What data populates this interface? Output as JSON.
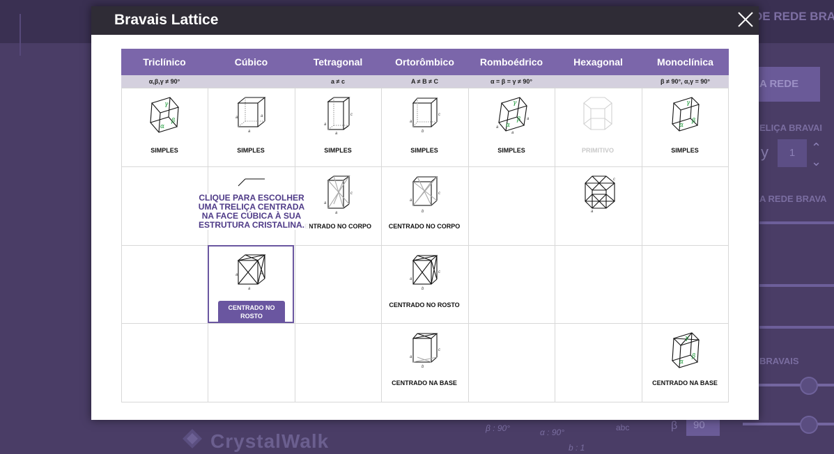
{
  "modal": {
    "title": "Bravais Lattice",
    "close_label": "×"
  },
  "table": {
    "columns": [
      {
        "name": "Triclínico",
        "condition": "α,β,γ ≠ 90°"
      },
      {
        "name": "Cúbico",
        "condition": ""
      },
      {
        "name": "Tetragonal",
        "condition": "a ≠ c"
      },
      {
        "name": "Ortorômbico",
        "condition": "A ≠ B ≠ C"
      },
      {
        "name": "Romboédrico",
        "condition": "α = β = γ ≠ 90°"
      },
      {
        "name": "Hexagonal",
        "condition": ""
      },
      {
        "name": "Monoclínica",
        "condition": "β ≠ 90°, α,γ = 90°"
      }
    ],
    "row1": {
      "triclinic": "SIMPLES",
      "cubic": "SIMPLES",
      "tetragonal": "SIMPLES",
      "orthorhombic": "SIMPLES",
      "rhombohedral": "SIMPLES",
      "hexagonal": "PRIMITIVO",
      "monoclinic": "SIMPLES"
    },
    "row2": {
      "cubic": "",
      "tetragonal": "ENTRADO NO CORPO",
      "orthorhombic": "CENTRADO NO CORPO"
    },
    "row3": {
      "cubic": "CENTRADO NO ROSTO",
      "orthorhombic": "CENTRADO NO ROSTO"
    },
    "row4": {
      "orthorhombic": "CENTRADO NA BASE",
      "monoclinic": "CENTRADO NA BASE"
    }
  },
  "tooltip": {
    "text": "CLIQUE PARA ESCOLHER UMA TRELIÇA CENTRADA NA FACE CÚBICA À SUA ESTRUTURA CRISTALINA."
  },
  "background": {
    "side_title": "DE REDE BRA",
    "rede_button": "A REDE",
    "trelica_label": "ELIÇA BRAVAI",
    "y_label": "y",
    "y_value": "1",
    "rede_bravais_label": "A REDE BRAVA",
    "bravais_label": "BRAVAIS",
    "beta_label": "β",
    "beta_value": "90",
    "logo": "CrystalWalk",
    "axis_beta": "β : 90°",
    "axis_alpha": "α : 90°",
    "axis_b": "b : 1",
    "abc_icon_label": "abc"
  },
  "colors": {
    "header_purple": "#7b66aa",
    "accent_purple": "#6a56a0",
    "modal_header": "#2f2c36",
    "background": "#4a3d66"
  }
}
